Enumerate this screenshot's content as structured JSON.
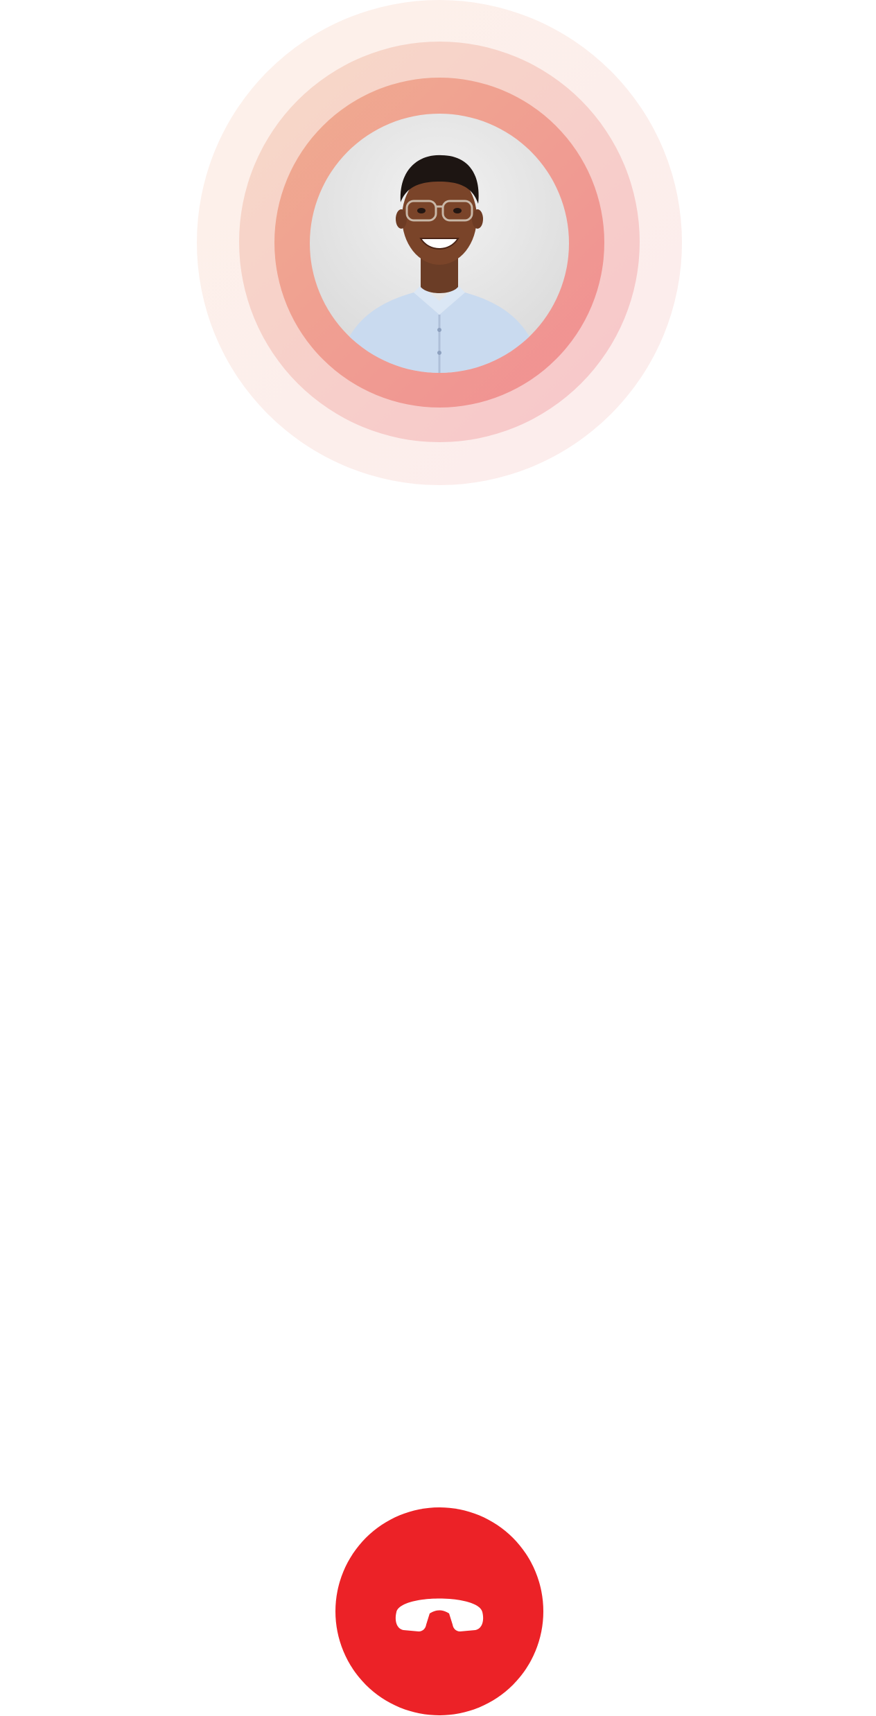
{
  "call": {
    "avatar_description_icon": "person-avatar",
    "ring_colors": [
      "#fdf1ea",
      "#f7d9c8",
      "#efac90"
    ],
    "end_call_icon": "phone-hangup-icon",
    "end_call_color": "#ec2227"
  }
}
